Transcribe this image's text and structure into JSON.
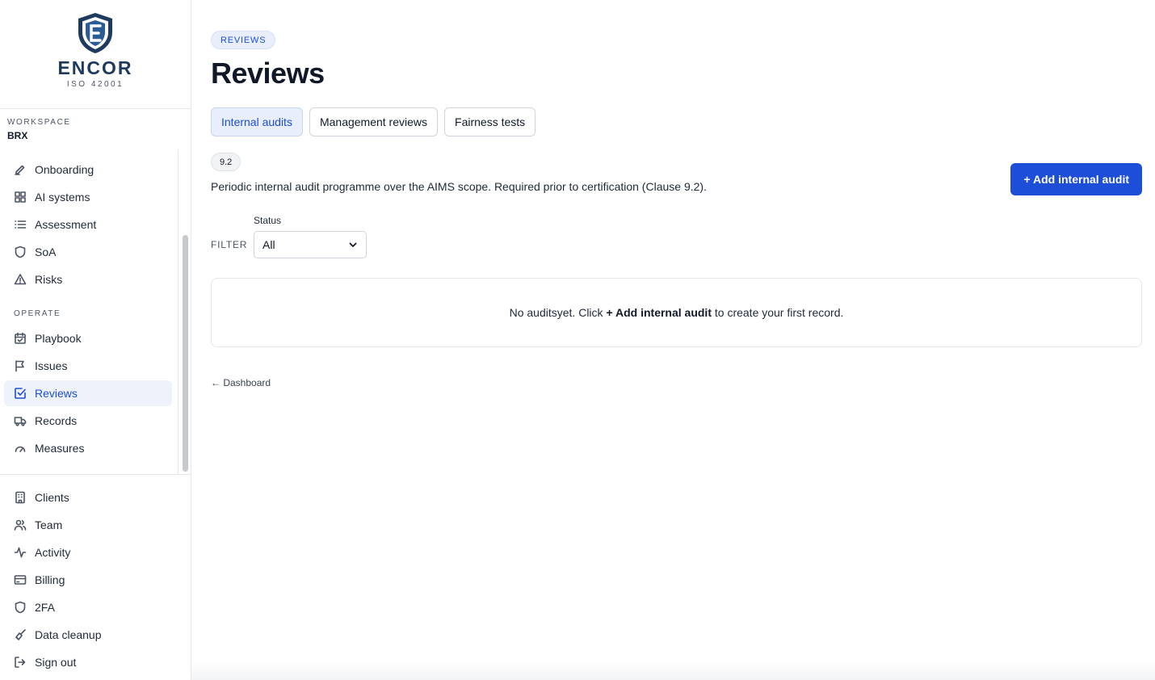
{
  "brand": {
    "name": "ENCOR",
    "subtitle": "ISO 42001"
  },
  "workspace": {
    "label": "WORKSPACE",
    "value": "BRX"
  },
  "nav": {
    "primary": [
      {
        "label": "Onboarding",
        "icon": "pen-icon"
      },
      {
        "label": "AI systems",
        "icon": "grid-icon"
      },
      {
        "label": "Assessment",
        "icon": "list-icon"
      },
      {
        "label": "SoA",
        "icon": "shield-icon"
      },
      {
        "label": "Risks",
        "icon": "warning-icon"
      }
    ],
    "operate_label": "OPERATE",
    "operate": [
      {
        "label": "Playbook",
        "icon": "calendar-check-icon"
      },
      {
        "label": "Issues",
        "icon": "flag-icon"
      },
      {
        "label": "Reviews",
        "icon": "check-square-icon",
        "active": true
      },
      {
        "label": "Records",
        "icon": "truck-icon"
      },
      {
        "label": "Measures",
        "icon": "gauge-icon"
      }
    ],
    "bottom": [
      {
        "label": "Clients",
        "icon": "building-icon"
      },
      {
        "label": "Team",
        "icon": "users-icon"
      },
      {
        "label": "Activity",
        "icon": "activity-icon"
      },
      {
        "label": "Billing",
        "icon": "credit-card-icon"
      },
      {
        "label": "2FA",
        "icon": "shield-icon"
      },
      {
        "label": "Data cleanup",
        "icon": "broom-icon"
      },
      {
        "label": "Sign out",
        "icon": "sign-out-icon"
      }
    ]
  },
  "page": {
    "pill": "REVIEWS",
    "title": "Reviews",
    "tabs": [
      {
        "label": "Internal audits",
        "active": true
      },
      {
        "label": "Management reviews"
      },
      {
        "label": "Fairness tests"
      }
    ],
    "clause_badge": "9.2",
    "description": "Periodic internal audit programme over the AIMS scope. Required prior to certification (Clause 9.2).",
    "add_button": "+ Add internal audit",
    "filter_label": "FILTER",
    "status_label": "Status",
    "status_value": "All",
    "empty": {
      "before": "No auditsyet. Click ",
      "strong": "+ Add internal audit",
      "after": " to create your first record."
    },
    "back_link": "← Dashboard"
  },
  "colors": {
    "accent": "#1d4ed8",
    "active_bg": "#eef2fb",
    "border": "#e5e7eb"
  }
}
